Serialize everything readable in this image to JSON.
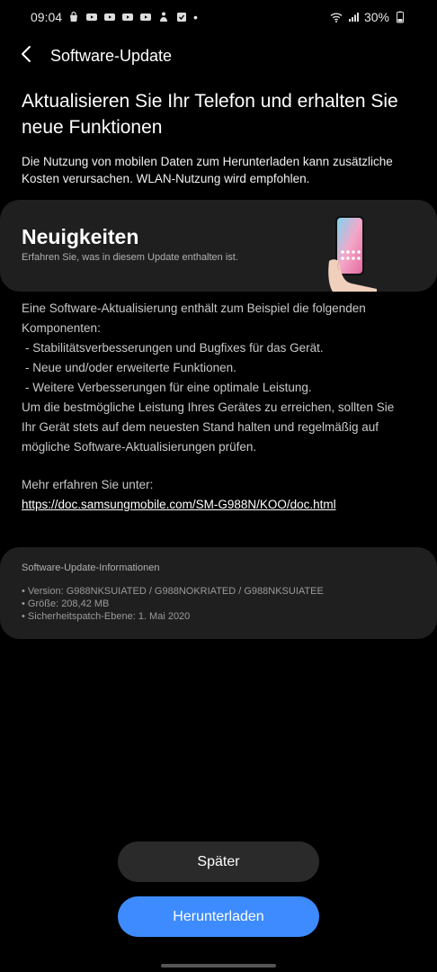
{
  "status_bar": {
    "time": "09:04",
    "battery": "30%",
    "dot": "•"
  },
  "header": {
    "title": "Software-Update"
  },
  "main": {
    "heading": "Aktualisieren Sie Ihr Telefon und erhalten Sie neue Funktionen",
    "intro": "Die Nutzung von mobilen Daten zum Herunterladen kann zusätzliche Kosten verursachen. WLAN-Nutzung wird empfohlen."
  },
  "news": {
    "title": "Neuigkeiten",
    "subtitle": "Erfahren Sie, was in diesem Update enthalten ist.",
    "intro_line": "Eine Software-Aktualisierung enthält zum Beispiel die folgenden Komponenten:",
    "items": [
      " - Stabilitätsverbesserungen und Bugfixes für das Gerät.",
      " - Neue und/oder erweiterte Funktionen.",
      " - Weitere Verbesserungen für eine optimale Leistung."
    ],
    "closing": "Um die bestmögliche Leistung Ihres Gerätes zu erreichen, sollten Sie Ihr Gerät stets auf dem neuesten Stand halten und regelmäßig auf mögliche Software-Aktualisierungen prüfen.",
    "more_label": "Mehr erfahren Sie unter:",
    "more_link": "https://doc.samsungmobile.com/SM-G988N/KOO/doc.html"
  },
  "info": {
    "title": "Software-Update-Informationen",
    "version": "• Version: G988NKSUIATED / G988NOKRIATED / G988NKSUIATEE",
    "size": "• Größe: 208,42 MB",
    "patch": "• Sicherheitspatch-Ebene: 1. Mai 2020"
  },
  "buttons": {
    "later": "Später",
    "download": "Herunterladen"
  },
  "colors": {
    "background": "#000000",
    "card": "#1f1f1f",
    "accent": "#3d8bff",
    "secondary_button": "#2a2a2a"
  },
  "icons": {
    "status_left": [
      "shopping-bag-icon",
      "youtube-icon",
      "youtube-icon",
      "youtube-icon",
      "youtube-icon",
      "person-icon",
      "checkbox-icon"
    ],
    "status_right": [
      "wifi-icon",
      "signal-icon",
      "battery-icon"
    ],
    "header": "back-arrow-icon"
  }
}
